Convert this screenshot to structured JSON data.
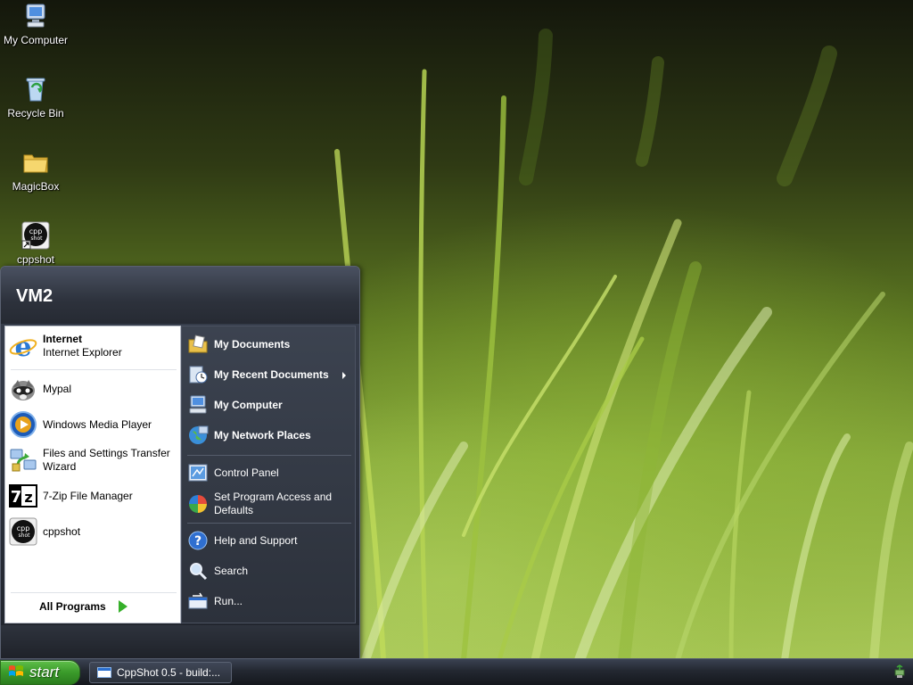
{
  "desktop": {
    "icons": [
      {
        "label": "My Computer",
        "icon": "my-computer-icon"
      },
      {
        "label": "Recycle Bin",
        "icon": "recycle-bin-icon"
      },
      {
        "label": "MagicBox",
        "icon": "folder-icon"
      },
      {
        "label": "cppshot",
        "icon": "cppshot-shortcut-icon"
      }
    ]
  },
  "start_menu": {
    "user_name": "VM2",
    "pinned": [
      {
        "title": "Internet",
        "subtitle": "Internet Explorer",
        "icon": "internet-explorer-icon"
      }
    ],
    "recent": [
      {
        "label": "Mypal",
        "icon": "mypal-icon"
      },
      {
        "label": "Windows Media Player",
        "icon": "windows-media-player-icon"
      },
      {
        "label": "Files and Settings Transfer Wizard",
        "icon": "transfer-wizard-icon"
      },
      {
        "label": "7-Zip File Manager",
        "icon": "7zip-icon"
      },
      {
        "label": "cppshot",
        "icon": "cppshot-icon"
      }
    ],
    "all_programs_label": "All Programs",
    "places": [
      {
        "label": "My Documents",
        "icon": "my-documents-icon"
      },
      {
        "label": "My Recent Documents",
        "icon": "recent-documents-icon"
      },
      {
        "label": "My Computer",
        "icon": "my-computer-icon"
      },
      {
        "label": "My Network Places",
        "icon": "network-places-icon"
      }
    ],
    "system": [
      {
        "label": "Control Panel",
        "icon": "control-panel-icon"
      },
      {
        "label": "Set Program Access and Defaults",
        "icon": "program-defaults-icon"
      }
    ],
    "help": [
      {
        "label": "Help and Support",
        "icon": "help-icon"
      },
      {
        "label": "Search",
        "icon": "search-icon"
      },
      {
        "label": "Run...",
        "icon": "run-icon"
      }
    ]
  },
  "taskbar": {
    "start_label": "start",
    "tasks": [
      {
        "label": "CppShot 0.5 - build:...",
        "icon": "window-icon"
      }
    ],
    "tray": [
      {
        "icon": "safely-remove-hardware-icon"
      }
    ]
  },
  "colors": {
    "start_button": "#3a9a2a",
    "menu_dark": "#2c313b",
    "taskbar": "#232831"
  }
}
